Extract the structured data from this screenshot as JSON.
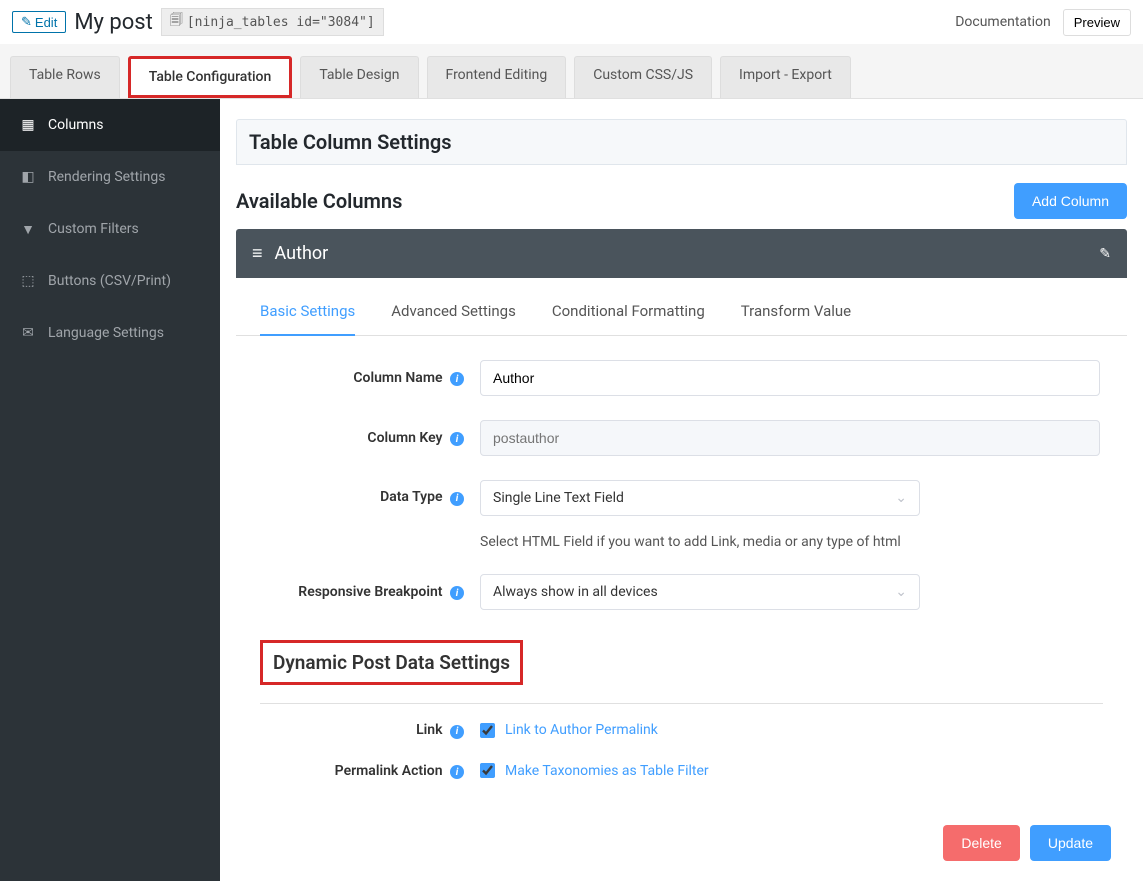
{
  "topbar": {
    "edit": "Edit",
    "title": "My post",
    "shortcode": "[ninja_tables id=\"3084\"]",
    "documentation": "Documentation",
    "preview": "Preview"
  },
  "tabs": {
    "rows": "Table Rows",
    "config": "Table Configuration",
    "design": "Table Design",
    "frontend": "Frontend Editing",
    "css": "Custom CSS/JS",
    "import": "Import - Export"
  },
  "sidebar": {
    "columns": "Columns",
    "rendering": "Rendering Settings",
    "filters": "Custom Filters",
    "buttons": "Buttons (CSV/Print)",
    "language": "Language Settings"
  },
  "content": {
    "section_heading": "Table Column Settings",
    "available": "Available Columns",
    "add_column": "Add Column",
    "column_name": "Author",
    "inner_tabs": {
      "basic": "Basic Settings",
      "advanced": "Advanced Settings",
      "conditional": "Conditional Formatting",
      "transform": "Transform Value"
    },
    "form": {
      "column_name_label": "Column Name",
      "column_name_value": "Author",
      "column_key_label": "Column Key",
      "column_key_placeholder": "postauthor",
      "data_type_label": "Data Type",
      "data_type_value": "Single Line Text Field",
      "data_type_hint": "Select HTML Field if you want to add Link, media or any type of html",
      "breakpoint_label": "Responsive Breakpoint",
      "breakpoint_value": "Always show in all devices"
    },
    "dynamic": {
      "heading": "Dynamic Post Data Settings",
      "link_label": "Link",
      "link_checkbox": "Link to Author Permalink",
      "permalink_label": "Permalink Action",
      "permalink_checkbox": "Make Taxonomies as Table Filter"
    },
    "buttons": {
      "delete": "Delete",
      "update": "Update"
    }
  }
}
